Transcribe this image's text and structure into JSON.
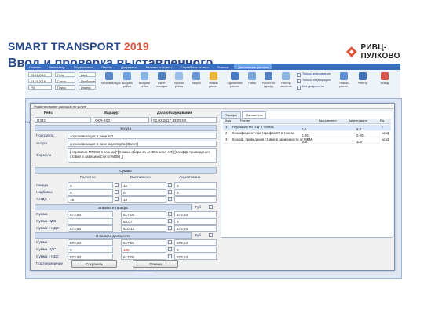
{
  "header": {
    "brand_main": "SMART TRANSPORT",
    "brand_year": "2019",
    "slide_title": "Ввод и проверка выставленного",
    "logo_text": "РИВЦ-ПУЛКОВО"
  },
  "menubar": {
    "items": [
      "Главная",
      "Навигатор",
      "Справочники",
      "Отчеты",
      "Документы",
      "Расчеты и отчеты",
      "Служебные отчеты",
      "Помощь",
      "Дополнения расчета"
    ]
  },
  "ribbon": {
    "fields": [
      "25.01.2019",
      "13.01.2019",
      "FM",
      "Рейс",
      "Сезон",
      "Поиск",
      "Дата",
      "Прибытие",
      "Индекс"
    ],
    "buttons": [
      "Аэронавигация",
      "Выбрать рейсы",
      "Выбрать рейсы",
      "Взлет посадка",
      "Прочие рейсы",
      "Запрос",
      "Новый расчет",
      "Единичный расчет",
      "Поиск",
      "Расчет по тарифу",
      "Реестр расчетов",
      "Новый расчет",
      "Реестр",
      "Выход"
    ],
    "checks": [
      "Только информация",
      "Только подтвержден",
      "Без документов"
    ]
  },
  "dialog": {
    "title": "Редактирование расходов по услуге",
    "columns": {
      "flight": "Рейс",
      "route": "Маршрут",
      "service_date": "Дата обслуживания"
    },
    "values": {
      "flight": "U342",
      "route": "СКЧ-КХЗ",
      "service_date": "02.02.2017 13:25:00"
    },
    "service_header": "Услуга",
    "labels": {
      "division": "Подгруппа",
      "service": "Услуга",
      "formula": "Формула",
      "sums": "Суммы",
      "calculated": "Расчетно",
      "invoiced": "Выставлено",
      "accepted": "Акцептовано",
      "discount": "Скидка",
      "surcharge": "Надбавка",
      "vat_pct": "%НДС",
      "tariff_currency": "В валюте тарифа",
      "sum": "Сумма",
      "sum_vat": "Сумма НДС",
      "sum_with_vat": "Сумма с НДС",
      "doc_currency": "В валюте документа",
      "confirmed": "Подтверждение",
      "currency": "Руб"
    },
    "division_value": "Аэронавигация в зоне АП",
    "service_value": "Аэронавигация в зоне аэропорта (Взлет)",
    "formula_value": "[Норматив MTOW в тоннах]*[Ставка сбора за АНО в зоне АП]*[Коэфф. приведения ставки в зависимости от MBM_]",
    "discount": [
      "0",
      "15",
      "0"
    ],
    "surcharge": [
      "0",
      "0",
      "0"
    ],
    "vat_pct": [
      "18",
      "18",
      ""
    ],
    "tariff_sum": [
      "573,54",
      "517,05",
      "573,54"
    ],
    "tariff_vat": [
      "",
      "93,07",
      "0"
    ],
    "tariff_with_vat": [
      "573,54",
      "610,12",
      "573,54"
    ],
    "doc_sum": [
      "573,54",
      "517,05",
      "573,54"
    ],
    "doc_vat": [
      "0",
      "100",
      "0"
    ],
    "doc_with_vat": [
      "573,54",
      "617,05",
      "573,54"
    ],
    "save_label": "Сохранить",
    "cancel_label": "Отмена",
    "confirm_label": "Подтвердить"
  },
  "right_panel": {
    "tabs": [
      "Тарифы",
      "Параметры"
    ],
    "headers": [
      "Код",
      "Расчет",
      "Выставлено",
      "Акцептовано",
      "Ед."
    ],
    "rows": [
      {
        "code": "1",
        "name": "Норматив MTOW в тоннах",
        "calc": "6,0",
        "inv": "6,0",
        "acc": "",
        "unit": "т"
      },
      {
        "code": "2",
        "name": "Коэффициент при тарифах КГ в тоннах",
        "calc": "0,001",
        "inv": "0,001",
        "acc": "",
        "unit": "коэф"
      },
      {
        "code": "3",
        "name": "Коэфф. приведения ставки в зависимости от MBM_",
        "calc": "100",
        "inv": "100",
        "acc": "",
        "unit": "коэф"
      }
    ]
  },
  "right_column": [
    "Поиск",
    "Ед. изм",
    "услуга",
    "услуга",
    "услуга",
    "услуга",
    "услуга",
    "услуга",
    "услуга",
    "услуга",
    "услуга",
    "услуга",
    "услуга",
    "услуга",
    "услуга",
    "услуга",
    "услуга"
  ],
  "left_column": [
    "Рейс",
    "Рег",
    "B",
    "Гла",
    "Со",
    "По",
    "Вс"
  ],
  "colors": {
    "brand": "#2a4a8c",
    "accent": "#e0513a",
    "menubar": "#3a6fc0"
  }
}
